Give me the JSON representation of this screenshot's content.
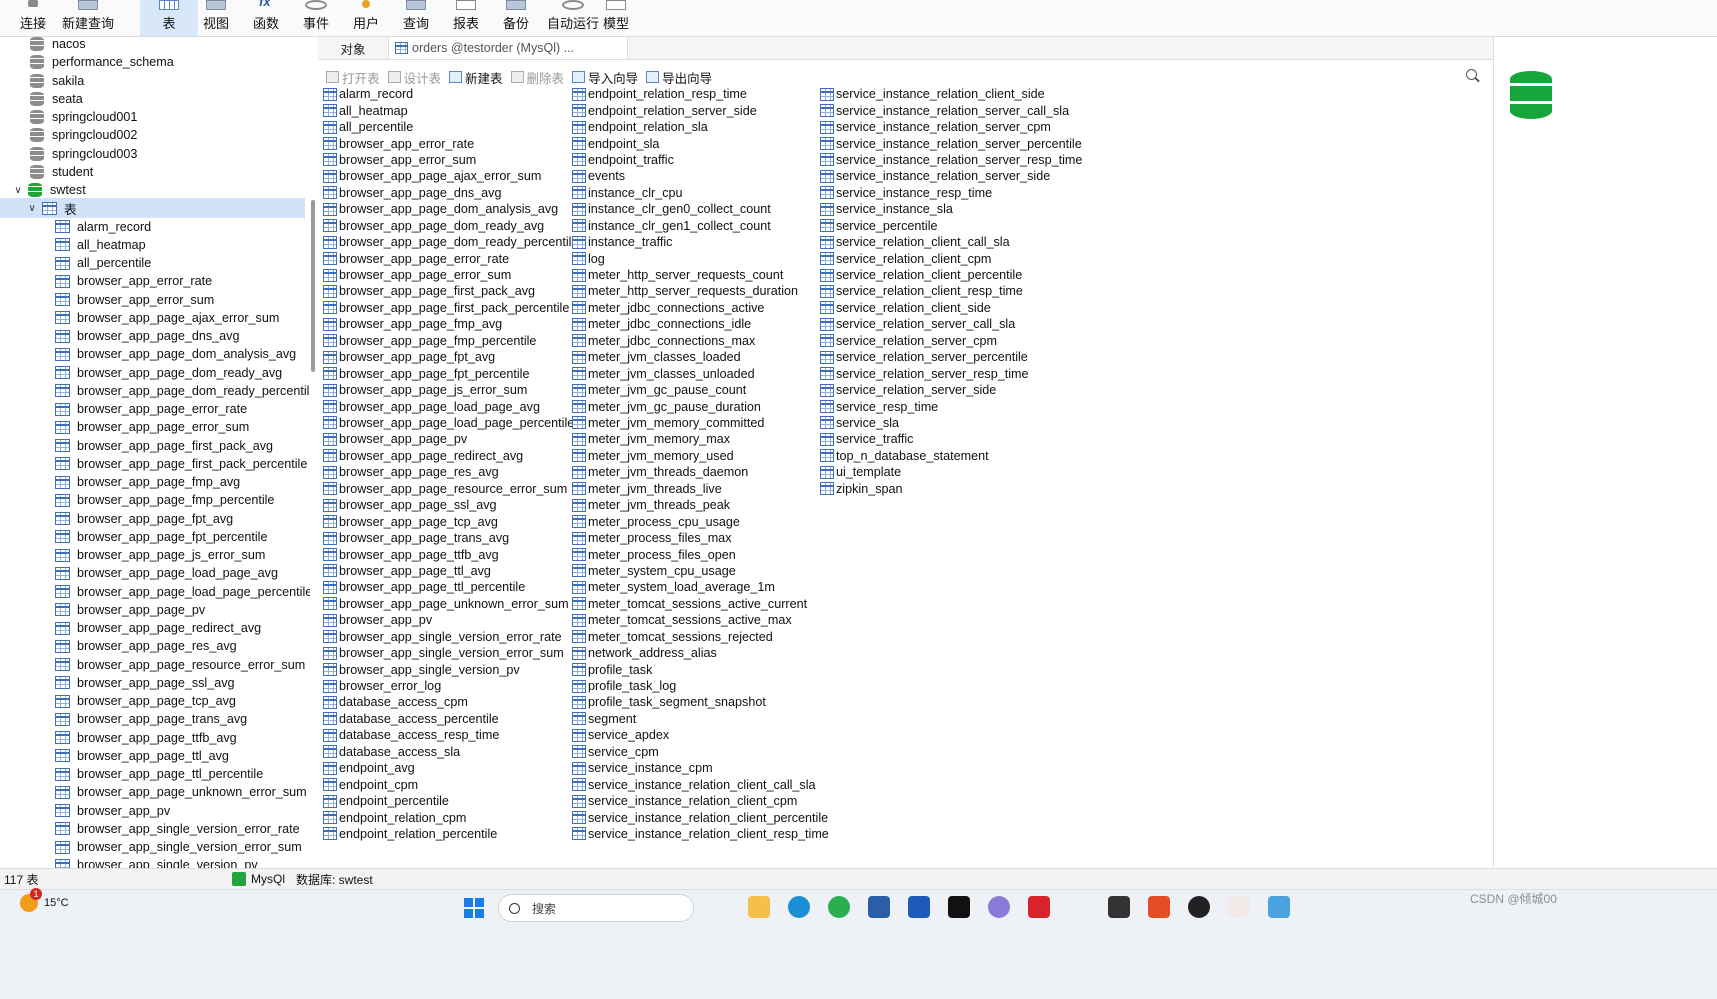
{
  "toolbar": {
    "items": [
      {
        "label": "连接",
        "icon": "plug-icon"
      },
      {
        "label": "新建查询",
        "icon": "new-query-icon"
      },
      {
        "label": "表",
        "icon": "table-icon",
        "active": true
      },
      {
        "label": "视图",
        "icon": "view-icon"
      },
      {
        "label": "函数",
        "icon": "function-icon"
      },
      {
        "label": "事件",
        "icon": "event-icon"
      },
      {
        "label": "用户",
        "icon": "user-icon"
      },
      {
        "label": "查询",
        "icon": "query-icon"
      },
      {
        "label": "报表",
        "icon": "report-icon"
      },
      {
        "label": "备份",
        "icon": "backup-icon"
      },
      {
        "label": "自动运行",
        "icon": "automation-icon"
      },
      {
        "label": "模型",
        "icon": "model-icon"
      }
    ]
  },
  "tree": {
    "databases": [
      "nacos",
      "performance_schema",
      "sakila",
      "seata",
      "springcloud001",
      "springcloud002",
      "springcloud003",
      "student"
    ],
    "open_db": "swtest",
    "tables_node": "表",
    "tables": [
      "alarm_record",
      "all_heatmap",
      "all_percentile",
      "browser_app_error_rate",
      "browser_app_error_sum",
      "browser_app_page_ajax_error_sum",
      "browser_app_page_dns_avg",
      "browser_app_page_dom_analysis_avg",
      "browser_app_page_dom_ready_avg",
      "browser_app_page_dom_ready_percentile",
      "browser_app_page_error_rate",
      "browser_app_page_error_sum",
      "browser_app_page_first_pack_avg",
      "browser_app_page_first_pack_percentile",
      "browser_app_page_fmp_avg",
      "browser_app_page_fmp_percentile",
      "browser_app_page_fpt_avg",
      "browser_app_page_fpt_percentile",
      "browser_app_page_js_error_sum",
      "browser_app_page_load_page_avg",
      "browser_app_page_load_page_percentile",
      "browser_app_page_pv",
      "browser_app_page_redirect_avg",
      "browser_app_page_res_avg",
      "browser_app_page_resource_error_sum",
      "browser_app_page_ssl_avg",
      "browser_app_page_tcp_avg",
      "browser_app_page_trans_avg",
      "browser_app_page_ttfb_avg",
      "browser_app_page_ttl_avg",
      "browser_app_page_ttl_percentile",
      "browser_app_page_unknown_error_sum",
      "browser_app_pv",
      "browser_app_single_version_error_rate",
      "browser_app_single_version_error_sum",
      "browser_app_single_version_pv"
    ]
  },
  "tabs": {
    "objects": "对象",
    "orders": "orders @testorder (MysQl) ..."
  },
  "subtoolbar": {
    "open": "打开表",
    "design": "设计表",
    "new": "新建表",
    "delete": "删除表",
    "import": "导入向导",
    "export": "导出向导"
  },
  "objects": {
    "col1": [
      "alarm_record",
      "all_heatmap",
      "all_percentile",
      "browser_app_error_rate",
      "browser_app_error_sum",
      "browser_app_page_ajax_error_sum",
      "browser_app_page_dns_avg",
      "browser_app_page_dom_analysis_avg",
      "browser_app_page_dom_ready_avg",
      "browser_app_page_dom_ready_percentile",
      "browser_app_page_error_rate",
      "browser_app_page_error_sum",
      "browser_app_page_first_pack_avg",
      "browser_app_page_first_pack_percentile",
      "browser_app_page_fmp_avg",
      "browser_app_page_fmp_percentile",
      "browser_app_page_fpt_avg",
      "browser_app_page_fpt_percentile",
      "browser_app_page_js_error_sum",
      "browser_app_page_load_page_avg",
      "browser_app_page_load_page_percentile",
      "browser_app_page_pv",
      "browser_app_page_redirect_avg",
      "browser_app_page_res_avg",
      "browser_app_page_resource_error_sum",
      "browser_app_page_ssl_avg",
      "browser_app_page_tcp_avg",
      "browser_app_page_trans_avg",
      "browser_app_page_ttfb_avg",
      "browser_app_page_ttl_avg",
      "browser_app_page_ttl_percentile",
      "browser_app_page_unknown_error_sum",
      "browser_app_pv",
      "browser_app_single_version_error_rate",
      "browser_app_single_version_error_sum",
      "browser_app_single_version_pv",
      "browser_error_log",
      "database_access_cpm",
      "database_access_percentile",
      "database_access_resp_time",
      "database_access_sla",
      "endpoint_avg",
      "endpoint_cpm",
      "endpoint_percentile",
      "endpoint_relation_cpm",
      "endpoint_relation_percentile"
    ],
    "col2": [
      "endpoint_relation_resp_time",
      "endpoint_relation_server_side",
      "endpoint_relation_sla",
      "endpoint_sla",
      "endpoint_traffic",
      "events",
      "instance_clr_cpu",
      "instance_clr_gen0_collect_count",
      "instance_clr_gen1_collect_count",
      "instance_traffic",
      "log",
      "meter_http_server_requests_count",
      "meter_http_server_requests_duration",
      "meter_jdbc_connections_active",
      "meter_jdbc_connections_idle",
      "meter_jdbc_connections_max",
      "meter_jvm_classes_loaded",
      "meter_jvm_classes_unloaded",
      "meter_jvm_gc_pause_count",
      "meter_jvm_gc_pause_duration",
      "meter_jvm_memory_committed",
      "meter_jvm_memory_max",
      "meter_jvm_memory_used",
      "meter_jvm_threads_daemon",
      "meter_jvm_threads_live",
      "meter_jvm_threads_peak",
      "meter_process_cpu_usage",
      "meter_process_files_max",
      "meter_process_files_open",
      "meter_system_cpu_usage",
      "meter_system_load_average_1m",
      "meter_tomcat_sessions_active_current",
      "meter_tomcat_sessions_active_max",
      "meter_tomcat_sessions_rejected",
      "network_address_alias",
      "profile_task",
      "profile_task_log",
      "profile_task_segment_snapshot",
      "segment",
      "service_apdex",
      "service_cpm",
      "service_instance_cpm",
      "service_instance_relation_client_call_sla",
      "service_instance_relation_client_cpm",
      "service_instance_relation_client_percentile",
      "service_instance_relation_client_resp_time"
    ],
    "col3": [
      "service_instance_relation_client_side",
      "service_instance_relation_server_call_sla",
      "service_instance_relation_server_cpm",
      "service_instance_relation_server_percentile",
      "service_instance_relation_server_resp_time",
      "service_instance_relation_server_side",
      "service_instance_resp_time",
      "service_instance_sla",
      "service_percentile",
      "service_relation_client_call_sla",
      "service_relation_client_cpm",
      "service_relation_client_percentile",
      "service_relation_client_resp_time",
      "service_relation_client_side",
      "service_relation_server_call_sla",
      "service_relation_server_cpm",
      "service_relation_server_percentile",
      "service_relation_server_resp_time",
      "service_relation_server_side",
      "service_resp_time",
      "service_sla",
      "service_traffic",
      "top_n_database_statement",
      "ui_template",
      "zipkin_span"
    ]
  },
  "status": {
    "count": "117 表",
    "connection": "MysQl",
    "database": "数据库: swtest"
  },
  "taskbar": {
    "temperature": "15°C",
    "badge": "1",
    "search_placeholder": "搜索",
    "watermark": "CSDN @倾城00"
  }
}
